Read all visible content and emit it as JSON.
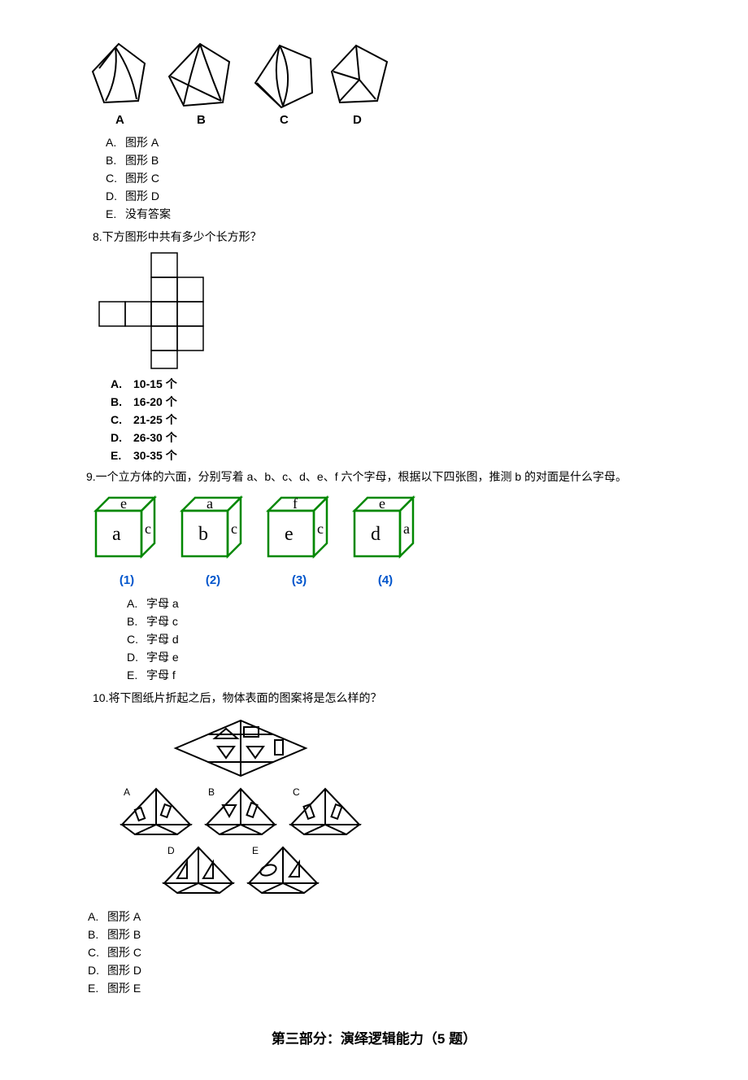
{
  "q7": {
    "labels": {
      "a": "A",
      "b": "B",
      "c": "C",
      "d": "D"
    },
    "opts": {
      "a": "图形 A",
      "b": "图形 B",
      "c": "图形 C",
      "d": "图形 D",
      "e": "没有答案"
    },
    "letters": {
      "a": "A.",
      "b": "B.",
      "c": "C.",
      "d": "D.",
      "e": "E."
    }
  },
  "q8": {
    "text": "8.下方图形中共有多少个长方形？",
    "opts": {
      "a": "10-15 个",
      "b": "16-20 个",
      "c": "21-25 个",
      "d": "26-30 个",
      "e": "30-35 个"
    },
    "letters": {
      "a": "A.",
      "b": "B.",
      "c": "C.",
      "d": "D.",
      "e": "E."
    }
  },
  "q9": {
    "text": "9.一个立方体的六面，分别写着 a、b、c、d、e、f 六个字母，根据以下四张图，推测 b 的对面是什么字母。",
    "cubes": {
      "c1": {
        "top": "e",
        "front": "a",
        "side": "c",
        "label": "(1)"
      },
      "c2": {
        "top": "a",
        "front": "b",
        "side": "c",
        "label": "(2)"
      },
      "c3": {
        "top": "f",
        "front": "e",
        "side": "c",
        "label": "(3)"
      },
      "c4": {
        "top": "e",
        "front": "d",
        "side": "a",
        "label": "(4)"
      }
    },
    "opts": {
      "a": "字母 a",
      "b": "字母 c",
      "c": "字母 d",
      "d": "字母 e",
      "e": "字母 f"
    },
    "letters": {
      "a": "A.",
      "b": "B.",
      "c": "C.",
      "d": "D.",
      "e": "E."
    }
  },
  "q10": {
    "text": "10.将下图纸片折起之后，物体表面的图案将是怎么样的？",
    "labels": {
      "a": "A",
      "b": "B",
      "c": "C",
      "d": "D",
      "e": "E"
    },
    "opts": {
      "a": "图形 A",
      "b": "图形 B",
      "c": "图形 C",
      "d": "图形 D",
      "e": "图形 E"
    },
    "letters": {
      "a": "A.",
      "b": "B.",
      "c": "C.",
      "d": "D.",
      "e": "E."
    }
  },
  "section": {
    "title": "第三部分：演绎逻辑能力（5 题）"
  }
}
